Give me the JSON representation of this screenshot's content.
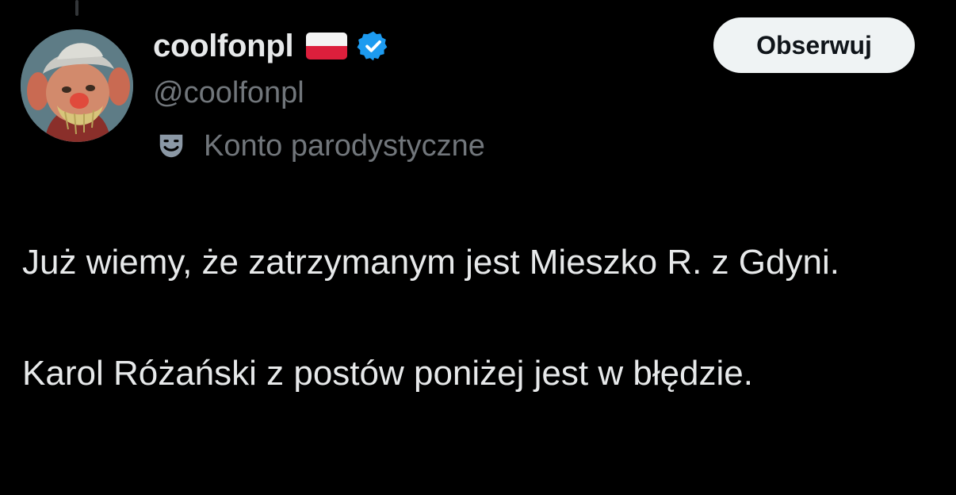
{
  "author": {
    "display_name": "coolfonpl",
    "flag": "poland-flag-icon",
    "verified_icon": "verified-badge-icon",
    "handle": "@coolfonpl",
    "label_icon": "theater-mask-icon",
    "label_text": "Konto parodystyczne"
  },
  "actions": {
    "follow_label": "Obserwuj"
  },
  "tweet": {
    "paragraph_1": "Już wiemy, że zatrzymanym jest Mieszko R. z Gdyni.",
    "paragraph_2": "Karol Różański z postów poniżej jest w błędzie."
  },
  "colors": {
    "background": "#000000",
    "primary_text": "#e7e9ea",
    "secondary_text": "#71767b",
    "verified_blue": "#1d9bf0",
    "button_bg": "#eff3f4",
    "button_text": "#0f1419"
  }
}
